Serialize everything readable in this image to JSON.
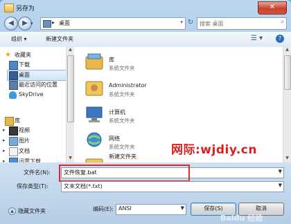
{
  "window": {
    "title": "另存为",
    "close_glyph": "✕"
  },
  "nav": {
    "back_glyph": "◀",
    "forward_glyph": "▶",
    "history_glyph": "▾",
    "address_sep": "▸",
    "address_path": "桌面",
    "address_drop": "▾",
    "refresh_glyph": "↻",
    "search_placeholder": "搜索 桌面",
    "search_glyph": "⌕"
  },
  "toolbar": {
    "organize": "组织 ▾",
    "new_folder": "新建文件夹",
    "view_glyph": "☰ ▾",
    "help_glyph": "?"
  },
  "sidebar": {
    "favorites_header": "收藏夹",
    "favorites": [
      {
        "label": "下载",
        "icon": "download-folder-icon"
      },
      {
        "label": "桌面",
        "icon": "desktop-icon"
      },
      {
        "label": "最近访问的位置",
        "icon": "recent-places-icon"
      },
      {
        "label": "SkyDrive",
        "icon": "cloud-icon"
      }
    ],
    "libraries_header": "库",
    "libraries": [
      {
        "label": "视频",
        "icon": "video-icon"
      },
      {
        "label": "图片",
        "icon": "picture-icon"
      },
      {
        "label": "文档",
        "icon": "document-icon"
      },
      {
        "label": "迅雷下载",
        "icon": "thunder-download-icon"
      }
    ]
  },
  "files": [
    {
      "name": "库",
      "type": "系统文件夹",
      "icon": "library-icon"
    },
    {
      "name": "Administrator",
      "type": "系统文件夹",
      "icon": "user-folder-icon"
    },
    {
      "name": "计算机",
      "type": "系统文件夹",
      "icon": "computer-icon"
    },
    {
      "name": "网络",
      "type": "系统文件夹",
      "icon": "network-icon"
    },
    {
      "name": "新建文件夹",
      "type": "",
      "icon": "folder-icon"
    }
  ],
  "watermark": "网际:wjdiy.cn",
  "form": {
    "filename_label": "文件名(N):",
    "filename_value": "文件恢复.bat",
    "filetype_label": "保存类型(T):",
    "filetype_value": "文本文档(*.txt)",
    "hide_folders": "隐藏文件夹",
    "encoding_label": "编码(E):",
    "encoding_value": "ANSI",
    "save_button": "保存(S)",
    "cancel_button": "取消"
  },
  "baidu_mark": "Baidu 经验",
  "colors": {
    "highlight": "#e0262b",
    "watermark": "#d8201e",
    "selection": "#cfe3f8"
  }
}
